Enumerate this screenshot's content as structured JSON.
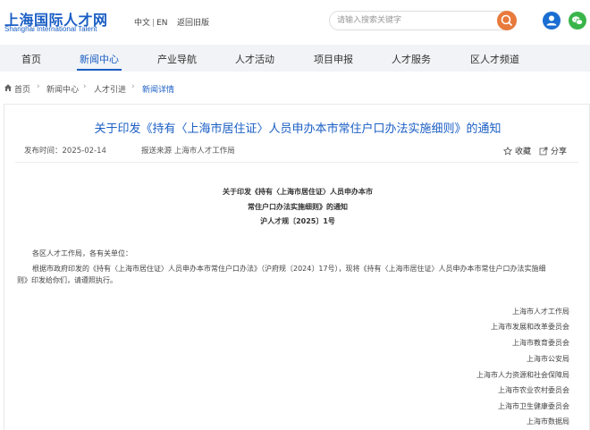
{
  "header": {
    "logo_cn": "上海国际人才网",
    "logo_en": "Shanghai International Talent",
    "lang_cn": "中文",
    "lang_sep": "|",
    "lang_en": "EN",
    "back_old": "返回旧版",
    "search_placeholder": "请输入搜索关键字"
  },
  "nav": {
    "items": [
      "首页",
      "新闻中心",
      "产业导航",
      "人才活动",
      "项目申报",
      "人才服务",
      "区人才频道"
    ],
    "active": "新闻中心"
  },
  "breadcrumb": [
    "首页",
    "新闻中心",
    "人才引进",
    "新闻详情"
  ],
  "article": {
    "title": "关于印发《持有〈上海市居住证〉人员申办本市常住户口办法实施细则》的通知",
    "publish_time": "发布时间：2025-02-14",
    "source": "报送来源 上海市人才工作局",
    "favorite_label": "收藏",
    "share_label": "分享",
    "doc_title_line1": "关于印发《持有〈上海市居住证〉人员申办本市",
    "doc_title_line2": "常住户口办法实施细则》的通知",
    "doc_number": "沪人才规〔2025〕1号",
    "greeting": "各区人才工作局，各有关单位：",
    "para_line1": "根据市政府印发的《持有〈上海市居住证〉人员申办本市常住户口办法》（沪府规〔2024〕17号），现将《持有〈上海市居住证〉人员申办本市常住户口办法实施细",
    "para_line2": "则》印发给你们，请遵照执行。",
    "signatories": [
      "上海市人才工作局",
      "上海市发展和改革委员会",
      "上海市教育委员会",
      "上海市公安局",
      "上海市人力资源和社会保障局",
      "上海市农业农村委员会",
      "上海市卫生健康委员会",
      "上海市数据局"
    ]
  },
  "colors": {
    "brand_blue": "#1a5ec4",
    "search_orange": "#e87a3b",
    "wechat_green": "#39b54a",
    "nav_bg": "#f1f3f6"
  }
}
